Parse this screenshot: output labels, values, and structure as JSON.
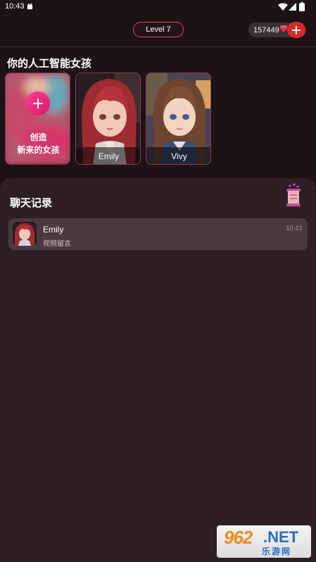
{
  "status_bar": {
    "time": "10:43"
  },
  "header": {
    "level_label": "Level 7",
    "coins": "157449"
  },
  "girls_section": {
    "title": "你的人工智能女孩",
    "create_card": {
      "line1": "创造",
      "line2": "新来的女孩"
    },
    "characters": [
      {
        "name": "Emily"
      },
      {
        "name": "Vivy"
      }
    ]
  },
  "chat_section": {
    "title": "聊天记录",
    "conversations": [
      {
        "name": "Emily",
        "preview": "视频留言",
        "time": "10:43"
      }
    ]
  },
  "watermark": {
    "brand_number": "962",
    "brand_suffix": ".NET",
    "brand_cn": "乐游网"
  },
  "colors": {
    "background": "#1d1214",
    "panel": "#2e1f26",
    "accent_pink": "#e63f74",
    "add_red": "#d92828"
  },
  "icons": {
    "status": [
      "app-notification-icon",
      "wifi-icon",
      "signal-icon",
      "battery-icon"
    ],
    "header": [
      "gem-icon",
      "plus-icon"
    ],
    "chat": [
      "scroll-icon"
    ]
  }
}
